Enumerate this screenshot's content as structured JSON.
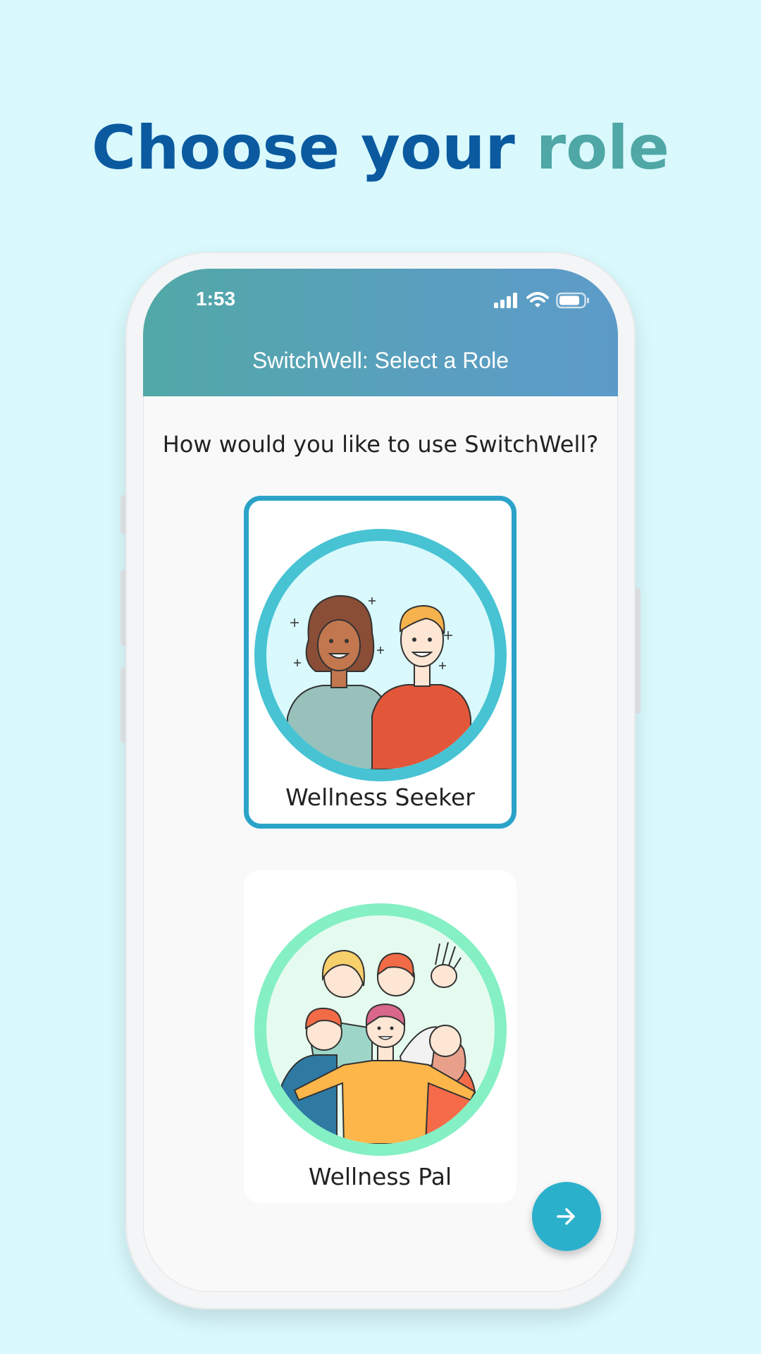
{
  "headline": {
    "part1": "Choose your",
    "part2": "role"
  },
  "status_bar": {
    "time": "1:53",
    "icons": [
      "signal-icon",
      "wifi-icon",
      "battery-icon"
    ]
  },
  "appbar": {
    "title": "SwitchWell: Select a Role"
  },
  "question": "How would you like to use SwitchWell?",
  "roles": [
    {
      "label": "Wellness Seeker",
      "selected": true,
      "illustration": "two-people-illustration"
    },
    {
      "label": "Wellness Pal",
      "selected": false,
      "illustration": "group-of-friends-illustration"
    }
  ],
  "fab": {
    "icon": "arrow-right-icon"
  },
  "colors": {
    "background": "#d9f9fd",
    "headline_primary": "#0b5aa0",
    "headline_accent": "#4fa7a6",
    "selected_border": "#2ba3c8",
    "seeker_ring": "#47c3d3",
    "pal_ring": "#84f0c4",
    "fab": "#2bb0cc"
  }
}
